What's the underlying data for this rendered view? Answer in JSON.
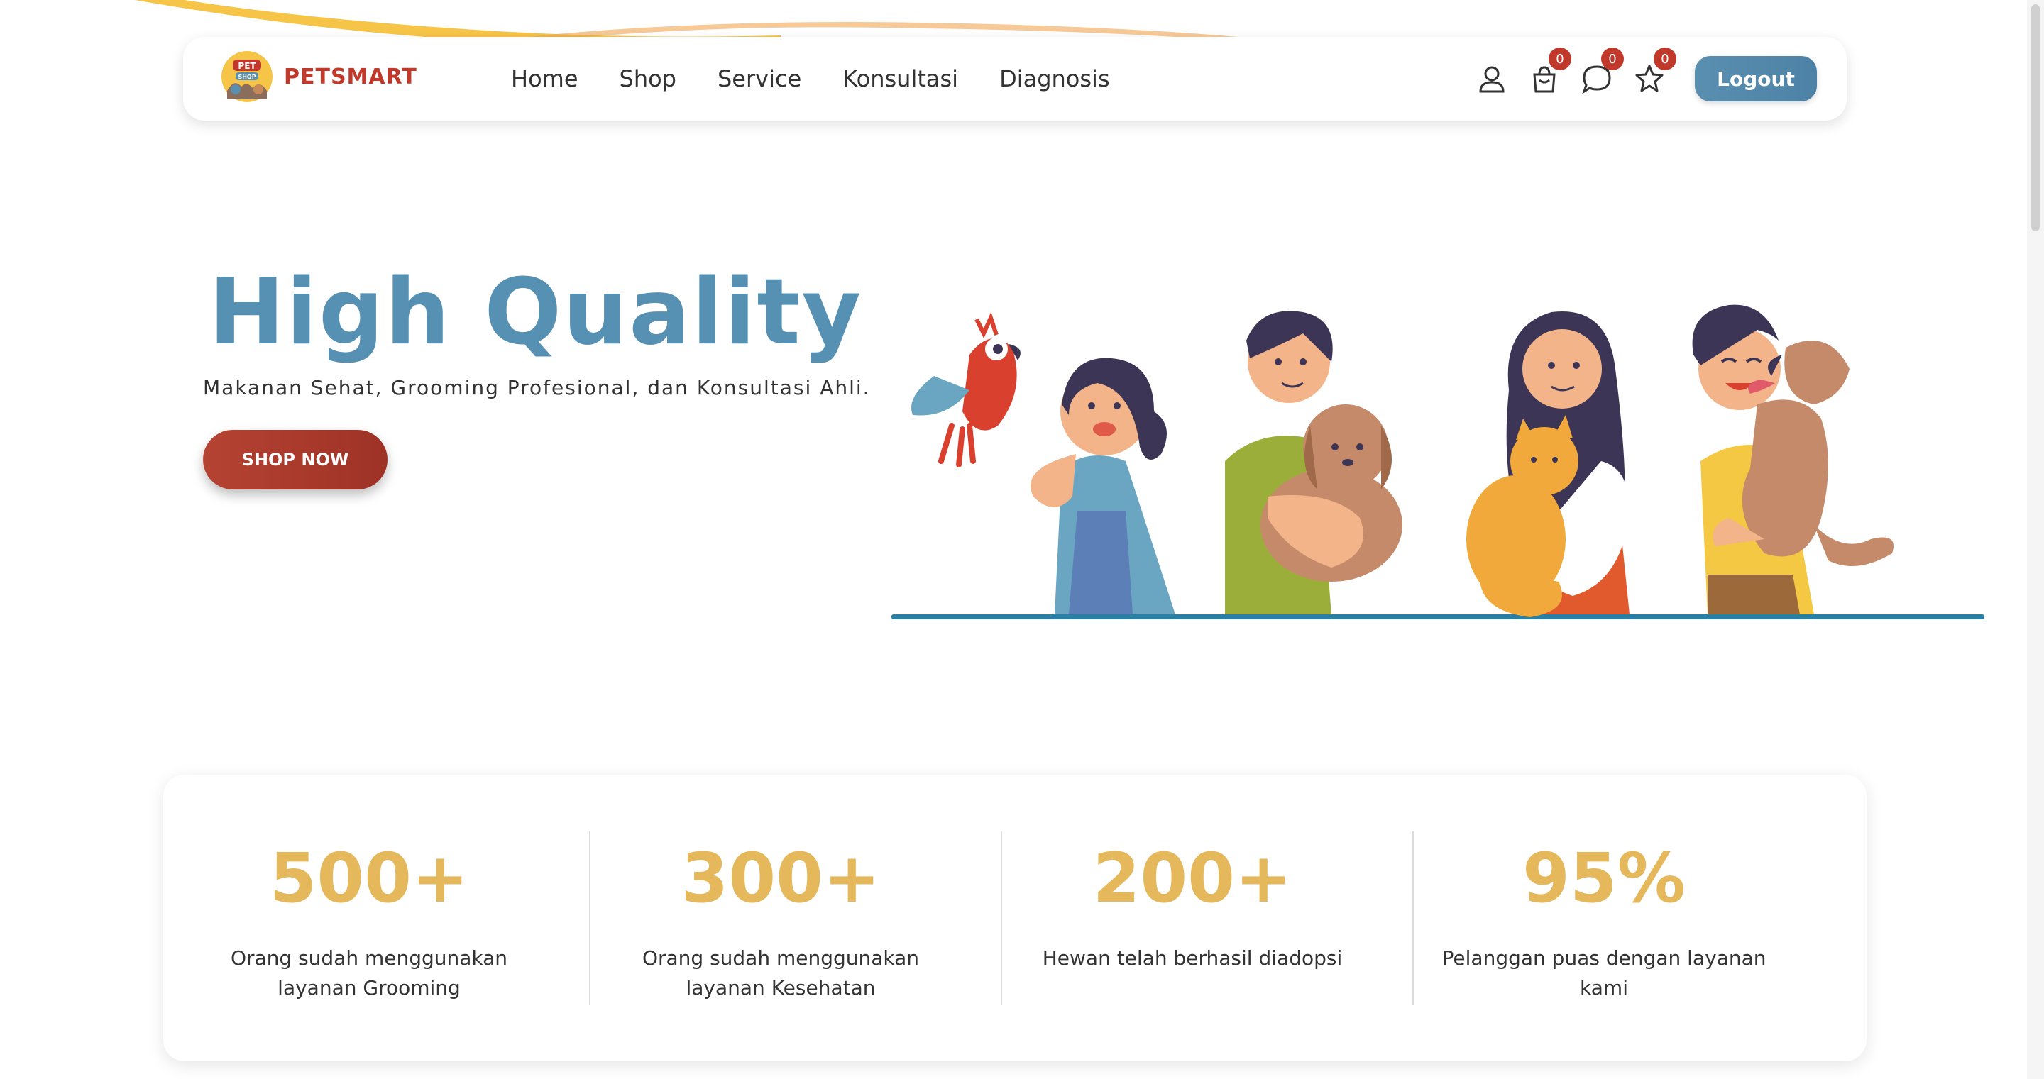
{
  "brand": {
    "name": "PETSMART",
    "logo_text_top": "PET",
    "logo_text_bottom": "SHOP"
  },
  "nav": {
    "links": [
      "Home",
      "Shop",
      "Service",
      "Konsultasi",
      "Diagnosis"
    ],
    "icons": [
      {
        "name": "user-icon",
        "badge": null
      },
      {
        "name": "cart-icon",
        "badge": "0"
      },
      {
        "name": "chat-icon",
        "badge": "0"
      },
      {
        "name": "star-icon",
        "badge": "0"
      }
    ],
    "logout_label": "Logout"
  },
  "hero": {
    "title": "High Quality",
    "subtitle": "Makanan Sehat, Grooming Profesional, dan Konsultasi Ahli.",
    "cta_label": "SHOP NOW"
  },
  "stats": [
    {
      "value": "500+",
      "label": "Orang sudah menggunakan layanan Grooming"
    },
    {
      "value": "300+",
      "label": "Orang sudah menggunakan layanan Kesehatan"
    },
    {
      "value": "200+",
      "label": "Hewan telah berhasil diadopsi"
    },
    {
      "value": "95%",
      "label": "Pelanggan puas dengan layanan kami"
    }
  ],
  "colors": {
    "primary": "#5690b3",
    "accent": "#c0392b",
    "stat": "#e5b85c"
  }
}
